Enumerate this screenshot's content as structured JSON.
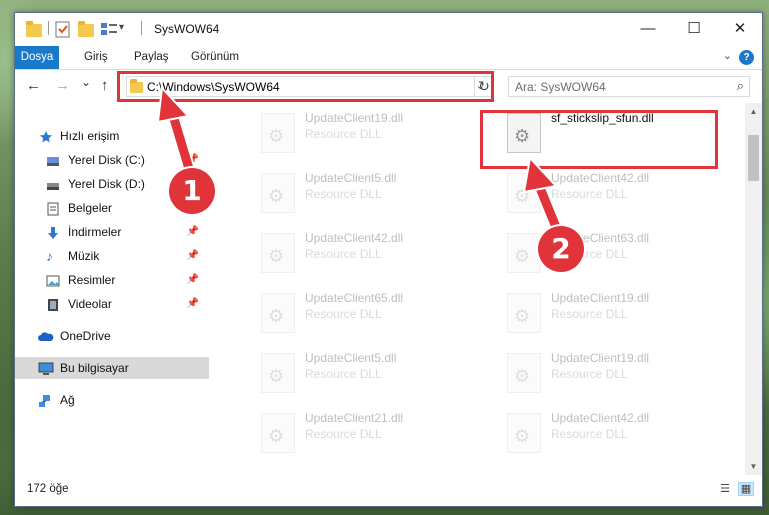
{
  "window": {
    "title": "SysWOW64",
    "controls": {
      "minimize": "—",
      "maximize": "☐",
      "close": "✕"
    }
  },
  "ribbon": {
    "tabs": [
      "Dosya",
      "Giriş",
      "Paylaş",
      "Görünüm"
    ],
    "help": "?"
  },
  "nav": {
    "back": "←",
    "forward": "→",
    "recent": "⌄",
    "up": "↑"
  },
  "address": {
    "path": "C:\\Windows\\SysWOW64",
    "dropdown": "⌄",
    "refresh": "↻"
  },
  "search": {
    "placeholder": "Ara: SysWOW64",
    "icon": "⌕"
  },
  "navpane": {
    "items": [
      {
        "label": "Hızlı erişim",
        "icon": "star-icon",
        "pinned": false
      },
      {
        "label": "Yerel Disk (C:)",
        "icon": "drive-icon",
        "pinned": true
      },
      {
        "label": "Yerel Disk (D:)",
        "icon": "drive-icon",
        "pinned": true
      },
      {
        "label": "Belgeler",
        "icon": "documents-icon",
        "pinned": true
      },
      {
        "label": "İndirmeler",
        "icon": "download-icon",
        "pinned": true
      },
      {
        "label": "Müzik",
        "icon": "music-icon",
        "pinned": true
      },
      {
        "label": "Resimler",
        "icon": "pictures-icon",
        "pinned": true
      },
      {
        "label": "Videolar",
        "icon": "videos-icon",
        "pinned": true
      },
      {
        "label": "OneDrive",
        "icon": "cloud-icon",
        "pinned": false
      },
      {
        "label": "Bu bilgisayar",
        "icon": "computer-icon",
        "pinned": false
      },
      {
        "label": "Ağ",
        "icon": "network-icon",
        "pinned": false
      }
    ]
  },
  "files": [
    {
      "name": "UpdateClient19.dll",
      "type": "Resource DLL",
      "faded": true
    },
    {
      "name": "sf_stickslip_sfun.dll",
      "type": "",
      "faded": false
    },
    {
      "name": "UpdateClient5.dll",
      "type": "Resource DLL",
      "faded": true
    },
    {
      "name": "UpdateClient42.dll",
      "type": "Resource DLL",
      "faded": true
    },
    {
      "name": "UpdateClient42.dll",
      "type": "Resource DLL",
      "faded": true
    },
    {
      "name": "UpdateClient63.dll",
      "type": "Resource DLL",
      "faded": true
    },
    {
      "name": "UpdateClient65.dll",
      "type": "Resource DLL",
      "faded": true
    },
    {
      "name": "UpdateClient19.dll",
      "type": "Resource DLL",
      "faded": true
    },
    {
      "name": "UpdateClient5.dll",
      "type": "Resource DLL",
      "faded": true
    },
    {
      "name": "UpdateClient19.dll",
      "type": "Resource DLL",
      "faded": true
    },
    {
      "name": "UpdateClient21.dll",
      "type": "Resource DLL",
      "faded": true
    },
    {
      "name": "UpdateClient42.dll",
      "type": "Resource DLL",
      "faded": true
    }
  ],
  "status": {
    "count": "172 öğe"
  },
  "annotations": {
    "step1": "1",
    "step2": "2",
    "color": "#e0343a"
  }
}
